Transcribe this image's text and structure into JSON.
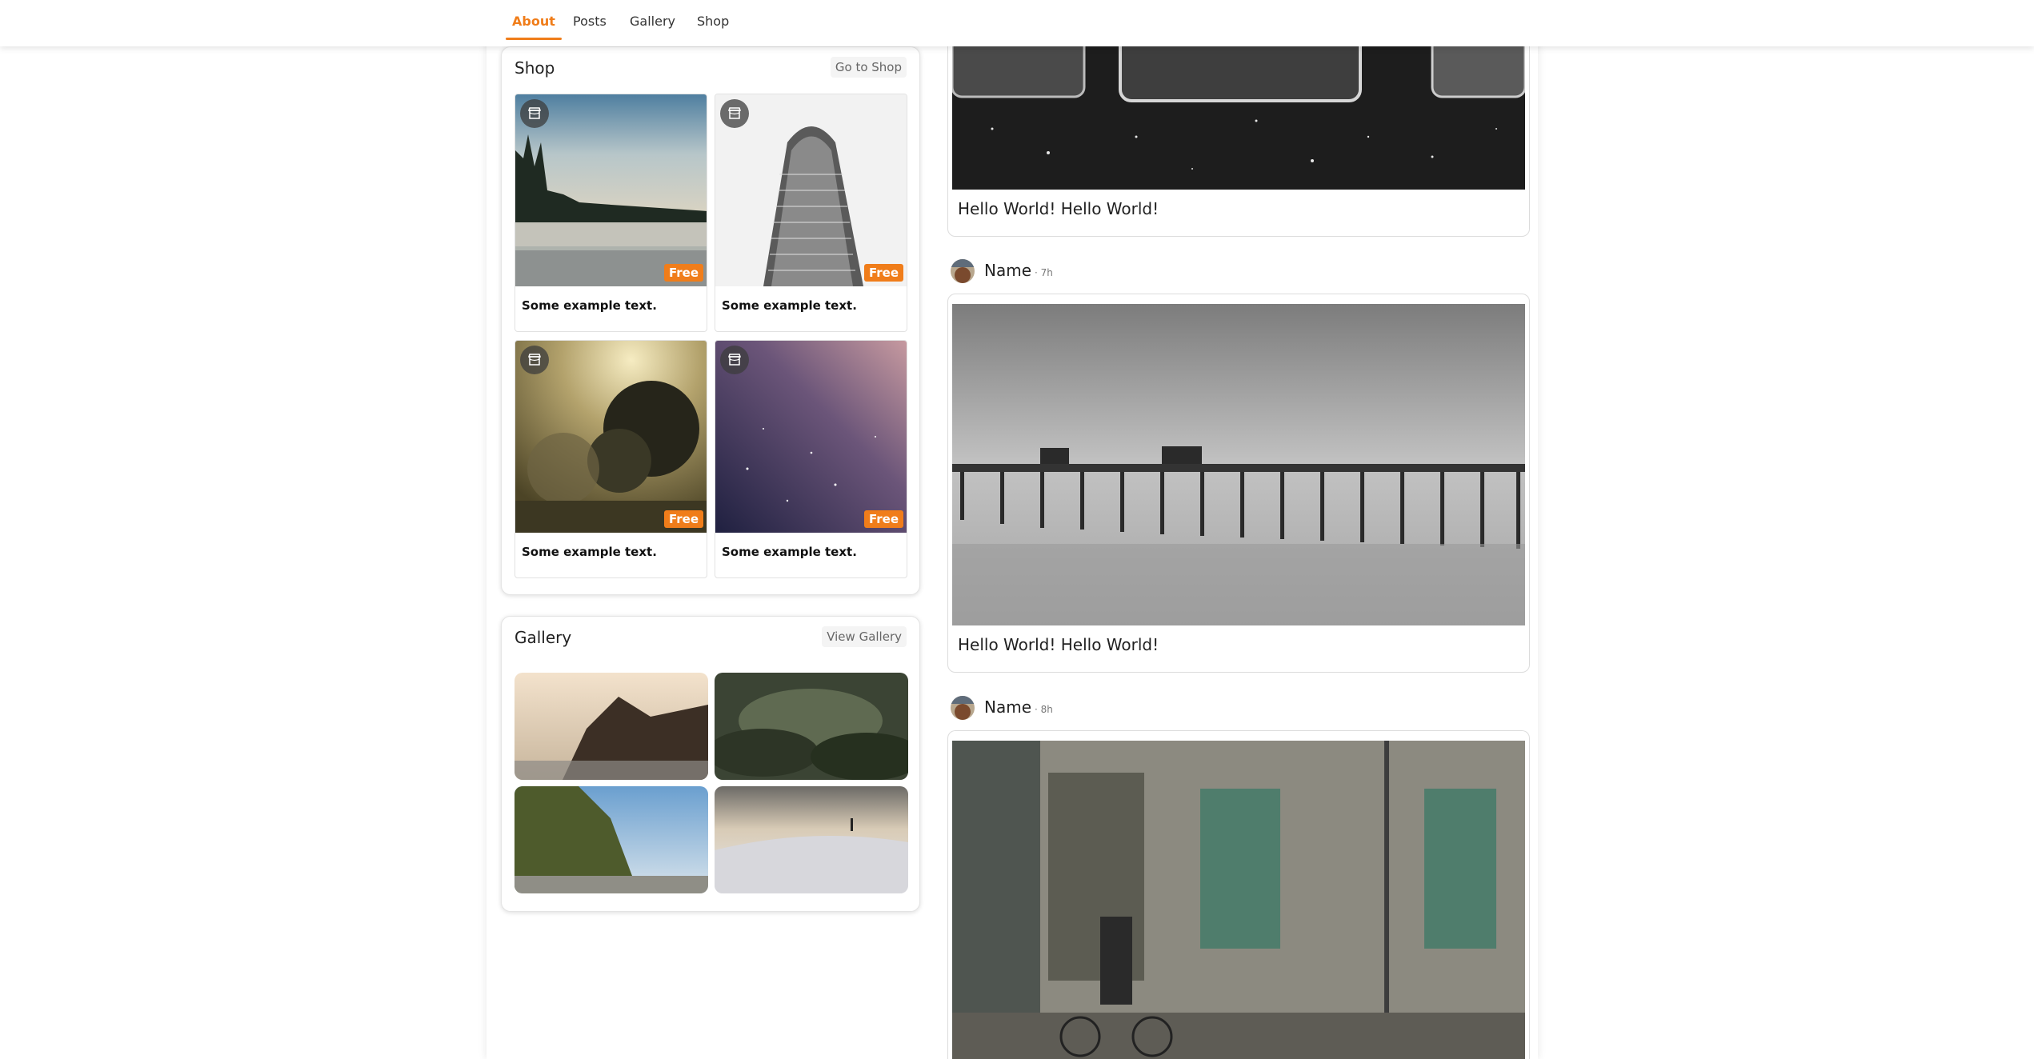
{
  "nav": {
    "tabs": [
      {
        "label": "About",
        "active": true
      },
      {
        "label": "Posts",
        "active": false
      },
      {
        "label": "Gallery",
        "active": false
      },
      {
        "label": "Shop",
        "active": false
      }
    ],
    "accent_color": "#f07d1a"
  },
  "shop": {
    "title": "Shop",
    "action_label": "Go to Shop",
    "items": [
      {
        "caption": "Some example text.",
        "badge": "Free",
        "icon": "store-icon"
      },
      {
        "caption": "Some example text.",
        "badge": "Free",
        "icon": "store-icon"
      },
      {
        "caption": "Some example text.",
        "badge": "Free",
        "icon": "store-icon"
      },
      {
        "caption": "Some example text.",
        "badge": "Free",
        "icon": "store-icon"
      }
    ]
  },
  "gallery": {
    "title": "Gallery",
    "action_label": "View Gallery"
  },
  "posts": [
    {
      "text": "Hello World! Hello World!"
    },
    {
      "author": "Name",
      "time": "· 7h",
      "text": "Hello World! Hello World!"
    },
    {
      "author": "Name",
      "time": "· 8h"
    }
  ]
}
